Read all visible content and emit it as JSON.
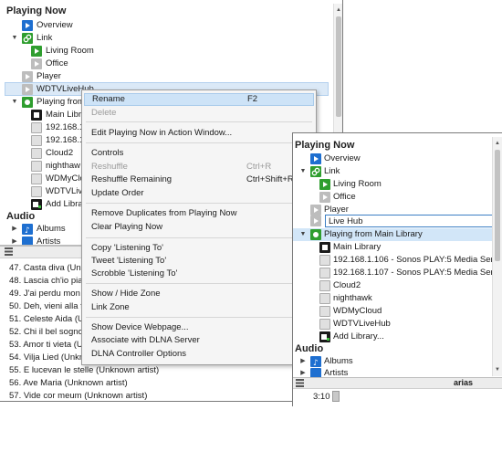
{
  "left_window": {
    "tree": {
      "playing_now_header": "Playing Now",
      "overview": "Overview",
      "link": "Link",
      "living_room": "Living Room",
      "office": "Office",
      "player": "Player",
      "wdtv": "WDTVLiveHub",
      "playing_from": "Playing from",
      "main_library": "Main Librar",
      "ip1": "192.168.1.",
      "ip2": "192.168.1.",
      "cloud2": "Cloud2",
      "nighthawk": "nighthaw",
      "wdmycloud": "WDMyClo",
      "wdtvlive": "WDTVLive",
      "add_library": "Add Libra",
      "audio_header": "Audio",
      "albums": "Albums",
      "artists": "Artists"
    },
    "list": [
      "47. Casta diva (Unkn",
      "48. Lascia ch'io pian",
      "49. J'ai perdu mon E",
      "50. Deh, vieni alla fe",
      "51. Celeste Aida (Un",
      "52. Chi il bel sogno",
      "53. Amor ti vieta (U",
      "54. Vilja Lied (Unkn",
      "55. E lucevan le stelle (Unknown artist)",
      "56. Ave Maria (Unknown artist)",
      "57. Vide cor meum (Unknown artist)"
    ]
  },
  "context_menu": {
    "rename": "Rename",
    "rename_shortcut": "F2",
    "delete": "Delete",
    "edit_playing_now": "Edit Playing Now in Action Window...",
    "controls": "Controls",
    "reshuffle": "Reshuffle",
    "reshuffle_shortcut": "Ctrl+R",
    "reshuffle_remaining": "Reshuffle Remaining",
    "reshuffle_remaining_shortcut": "Ctrl+Shift+R",
    "update_order": "Update Order",
    "remove_duplicates": "Remove Duplicates from Playing Now",
    "clear_playing_now": "Clear Playing Now",
    "copy_listening": "Copy 'Listening To'",
    "tweet_listening": "Tweet 'Listening To'",
    "scrobble_listening": "Scrobble 'Listening To'",
    "show_hide_zone": "Show / Hide Zone",
    "link_zone": "Link Zone",
    "show_device_webpage": "Show Device Webpage...",
    "associate_dlna": "Associate with DLNA Server",
    "dlna_options": "DLNA Controller Options"
  },
  "right_window": {
    "tree": {
      "playing_now_header": "Playing Now",
      "overview": "Overview",
      "link": "Link",
      "living_room": "Living Room",
      "office": "Office",
      "player": "Player",
      "rename_value": "Live Hub",
      "playing_from": "Playing from Main Library",
      "main_library": "Main Library",
      "sonos1": "192.168.1.106 - Sonos PLAY:5 Media Server",
      "sonos2": "192.168.1.107 - Sonos PLAY:5 Media Server",
      "cloud2": "Cloud2",
      "nighthawk": "nighthawk",
      "wdmycloud": "WDMyCloud",
      "wdtvlivehub": "WDTVLiveHub",
      "add_library": "Add Library...",
      "audio_header": "Audio",
      "albums": "Albums",
      "artists": "Artists"
    },
    "list_header_text": "arias",
    "list_time": "3:10"
  },
  "colors": {
    "selection": "#d2e6f8",
    "menu_highlight": "#cde3f7",
    "input_border": "#3c7fc4",
    "icon_blue": "#1e6fd0",
    "icon_green": "#2f9e2f",
    "icon_gray": "#9e9e9e"
  },
  "icons": [
    "overview-icon",
    "link-icon",
    "zone-play-icon",
    "zone-gray-icon",
    "library-icon",
    "server-icon",
    "add-library-icon",
    "music-note-icon",
    "list-view-icon"
  ]
}
